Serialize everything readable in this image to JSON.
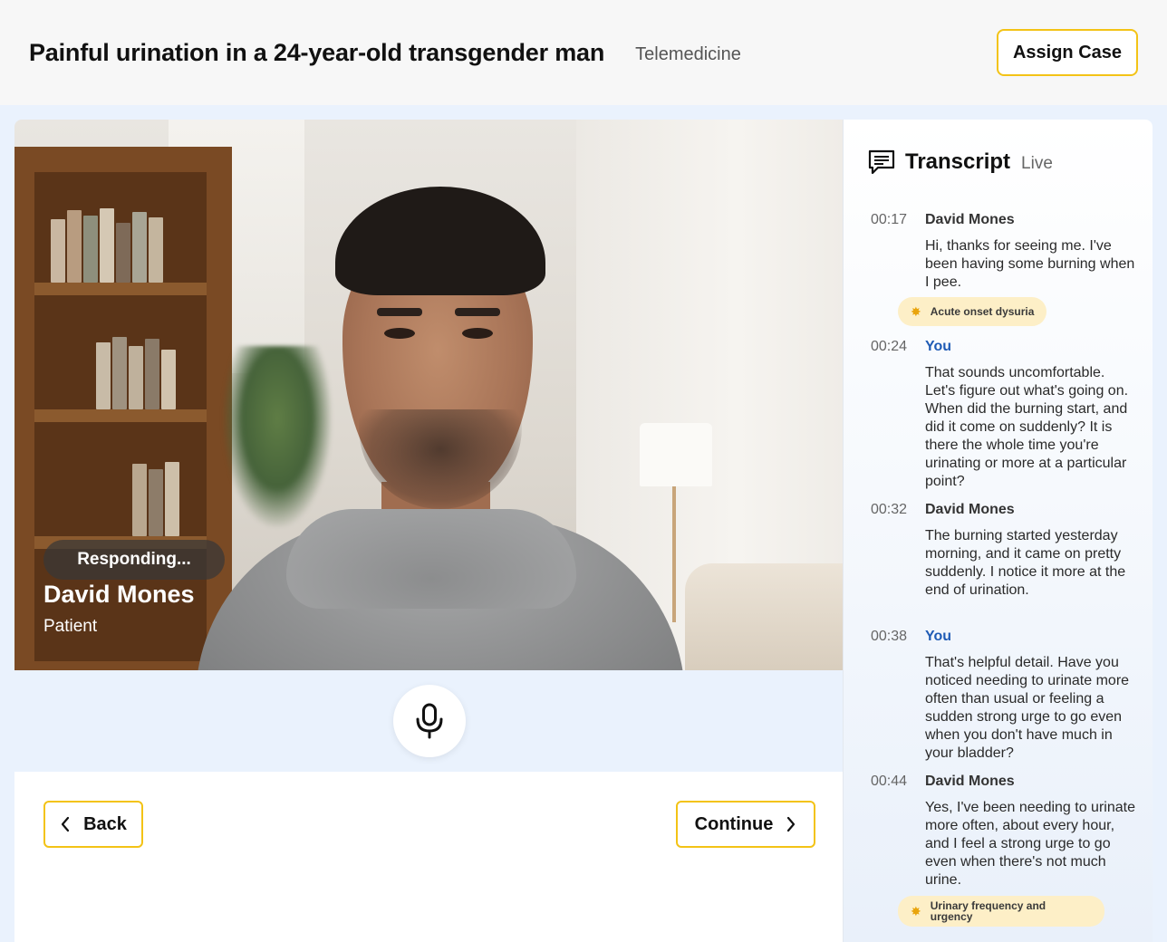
{
  "header": {
    "title": "Painful urination in a 24-year-old transgender man",
    "mode": "Telemedicine",
    "assign_label": "Assign Case"
  },
  "video": {
    "status": "Responding...",
    "patient_name": "David Mones",
    "patient_role": "Patient"
  },
  "controls": {
    "mic_icon": "microphone-icon",
    "back_label": "Back",
    "continue_label": "Continue"
  },
  "transcript": {
    "title": "Transcript",
    "live_label": "Live",
    "entries": [
      {
        "time": "00:17",
        "speaker": "David Mones",
        "text": "Hi, thanks for seeing me. I've been having some burning when I pee.",
        "tag": "Acute onset dysuria"
      },
      {
        "time": "00:24",
        "speaker": "You",
        "text": "That sounds uncomfortable. Let's figure out what's going on. When did the burning start, and did it come on suddenly? It is there the whole time you're urinating or more at a particular point?"
      },
      {
        "time": "00:32",
        "speaker": "David Mones",
        "text": "The burning started yesterday morning, and it came on pretty suddenly. I notice it more at the end of urination."
      },
      {
        "time": "00:38",
        "speaker": "You",
        "text": "That's helpful detail. Have you noticed needing to urinate more often than usual or feeling a sudden strong urge to go even when you don't have much in your bladder?"
      },
      {
        "time": "00:44",
        "speaker": "David Mones",
        "text": "Yes, I've been needing to urinate more often, about every hour, and I feel a strong urge to go even when there's not much urine.",
        "tag": "Urinary frequency and urgency"
      }
    ]
  },
  "colors": {
    "accent": "#f3c316",
    "you_speaker": "#1f5bb5",
    "tag_bg": "#fdefc7",
    "page_bg": "#eaf2fd"
  }
}
